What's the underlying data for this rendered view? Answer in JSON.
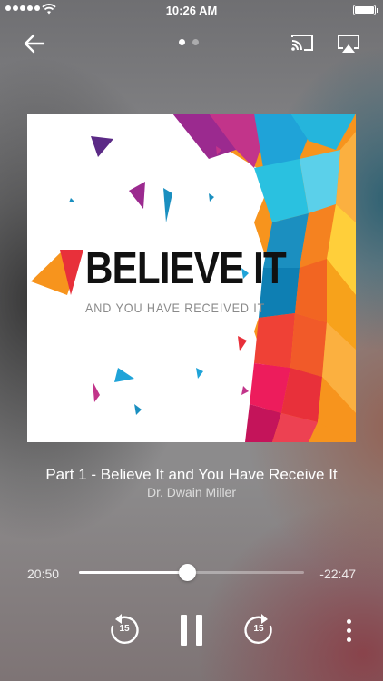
{
  "status_bar": {
    "time": "10:26 AM",
    "signal_icon": "signal-dots-icon",
    "wifi_icon": "wifi-icon",
    "battery_icon": "battery-full-icon"
  },
  "toolbar": {
    "back_icon": "arrow-left-icon",
    "page_indicator": {
      "count": 2,
      "active_index": 0
    },
    "cast_icon": "cast-icon",
    "airplay_icon": "airplay-icon"
  },
  "artwork": {
    "headline": "BELIEVE IT",
    "subline": "AND YOU HAVE RECEIVED IT"
  },
  "track": {
    "title": "Part 1 - Believe It and You Have Receive It",
    "artist": "Dr. Dwain Miller"
  },
  "playback": {
    "elapsed": "20:50",
    "remaining": "-22:47",
    "progress_fraction": 0.48
  },
  "controls": {
    "rewind_seconds": "15",
    "forward_seconds": "15",
    "rewind_icon": "rewind-15-icon",
    "pause_icon": "pause-icon",
    "forward_icon": "forward-15-icon",
    "more_icon": "more-vertical-icon"
  },
  "colors": {
    "background": "#8a8a8c",
    "accent": "#ffffff"
  }
}
